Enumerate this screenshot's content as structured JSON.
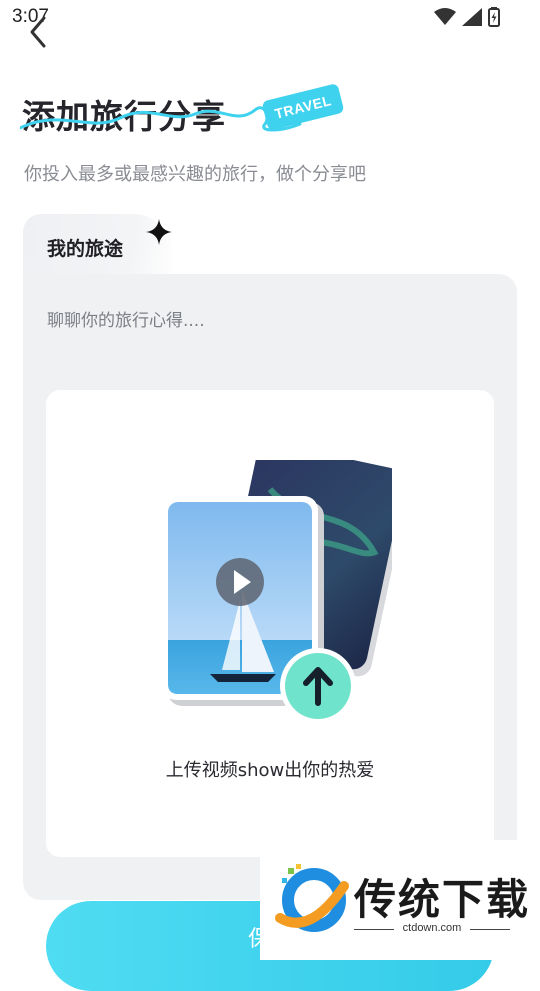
{
  "status_bar": {
    "time": "3:07",
    "icons": [
      "wifi-icon",
      "signal-icon",
      "battery-icon"
    ]
  },
  "header": {
    "back_icon": "chevron-left-icon",
    "title": "添加旅行分享",
    "tag": "TRAVEL",
    "subtitle": "你投入最多或最感兴趣的旅行，做个分享吧"
  },
  "card": {
    "tab_label": "我的旅途",
    "notes_placeholder": "聊聊你的旅行心得....",
    "upload_label": "上传视频show出你的热爱"
  },
  "footer": {
    "save_label": "保"
  },
  "watermark": {
    "name": "传统下载",
    "url": "ctdown.com"
  },
  "colors": {
    "accent": "#3ed2ef",
    "card_bg": "#f0f1f3",
    "upload_arrow_bg": "#6fe3cc"
  }
}
